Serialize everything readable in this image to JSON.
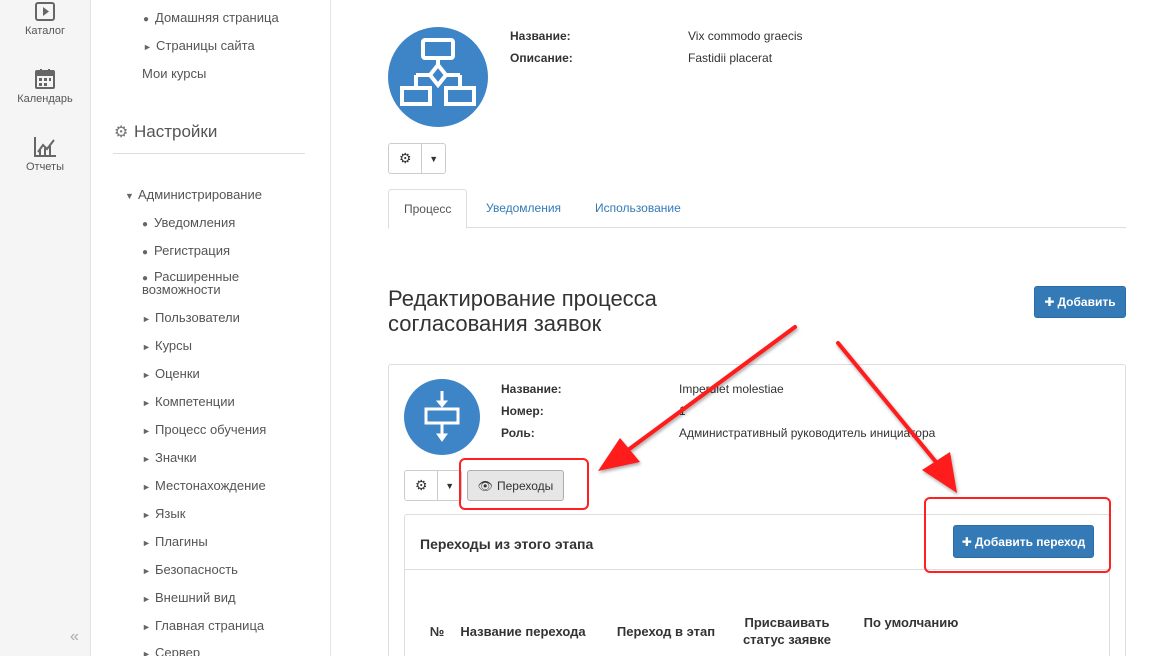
{
  "leftnav": {
    "items": [
      {
        "label": "Каталог",
        "icon": "catalog-icon"
      },
      {
        "label": "Календарь",
        "icon": "calendar-icon"
      },
      {
        "label": "Отчеты",
        "icon": "reports-icon"
      }
    ],
    "collapse": "«"
  },
  "sidebar": {
    "top_items": [
      "Домашняя страница",
      "Страницы сайта"
    ],
    "my_courses": "Мои курсы",
    "settings_heading": "Настройки",
    "admin": "Администрирование",
    "bullet_items": [
      "Уведомления",
      "Регистрация",
      "Расширенные",
      "возможности"
    ],
    "tri_items": [
      "Пользователи",
      "Курсы",
      "Оценки",
      "Компетенции",
      "Процесс обучения",
      "Значки",
      "Местонахождение",
      "Язык",
      "Плагины",
      "Безопасность",
      "Внешний вид",
      "Главная страница",
      "Сервер"
    ]
  },
  "process": {
    "name_label": "Название:",
    "name_value": "Vix commodo graecis",
    "desc_label": "Описание:",
    "desc_value": "Fastidii placerat"
  },
  "tabs": [
    "Процесс",
    "Уведомления",
    "Использование"
  ],
  "page_title_line1": "Редактирование процесса",
  "page_title_line2": "согласования заявок",
  "add_button": "Добавить",
  "stage": {
    "name_label": "Название:",
    "name_value": "Imperdiet molestiae",
    "number_label": "Номер:",
    "number_value": "1",
    "role_label": "Роль:",
    "role_value": "Административный руководитель инициатора"
  },
  "transitions_button": "Переходы",
  "transitions_panel": {
    "title": "Переходы из этого этапа",
    "add_transition": "Добавить переход",
    "columns": [
      "№",
      "Название перехода",
      "Переход в этап",
      "Присваивать статус заявке",
      "По умолчанию"
    ]
  },
  "colors": {
    "primary": "#337ab7",
    "icon_blue": "#3d85c6",
    "highlight": "#ff2020"
  }
}
